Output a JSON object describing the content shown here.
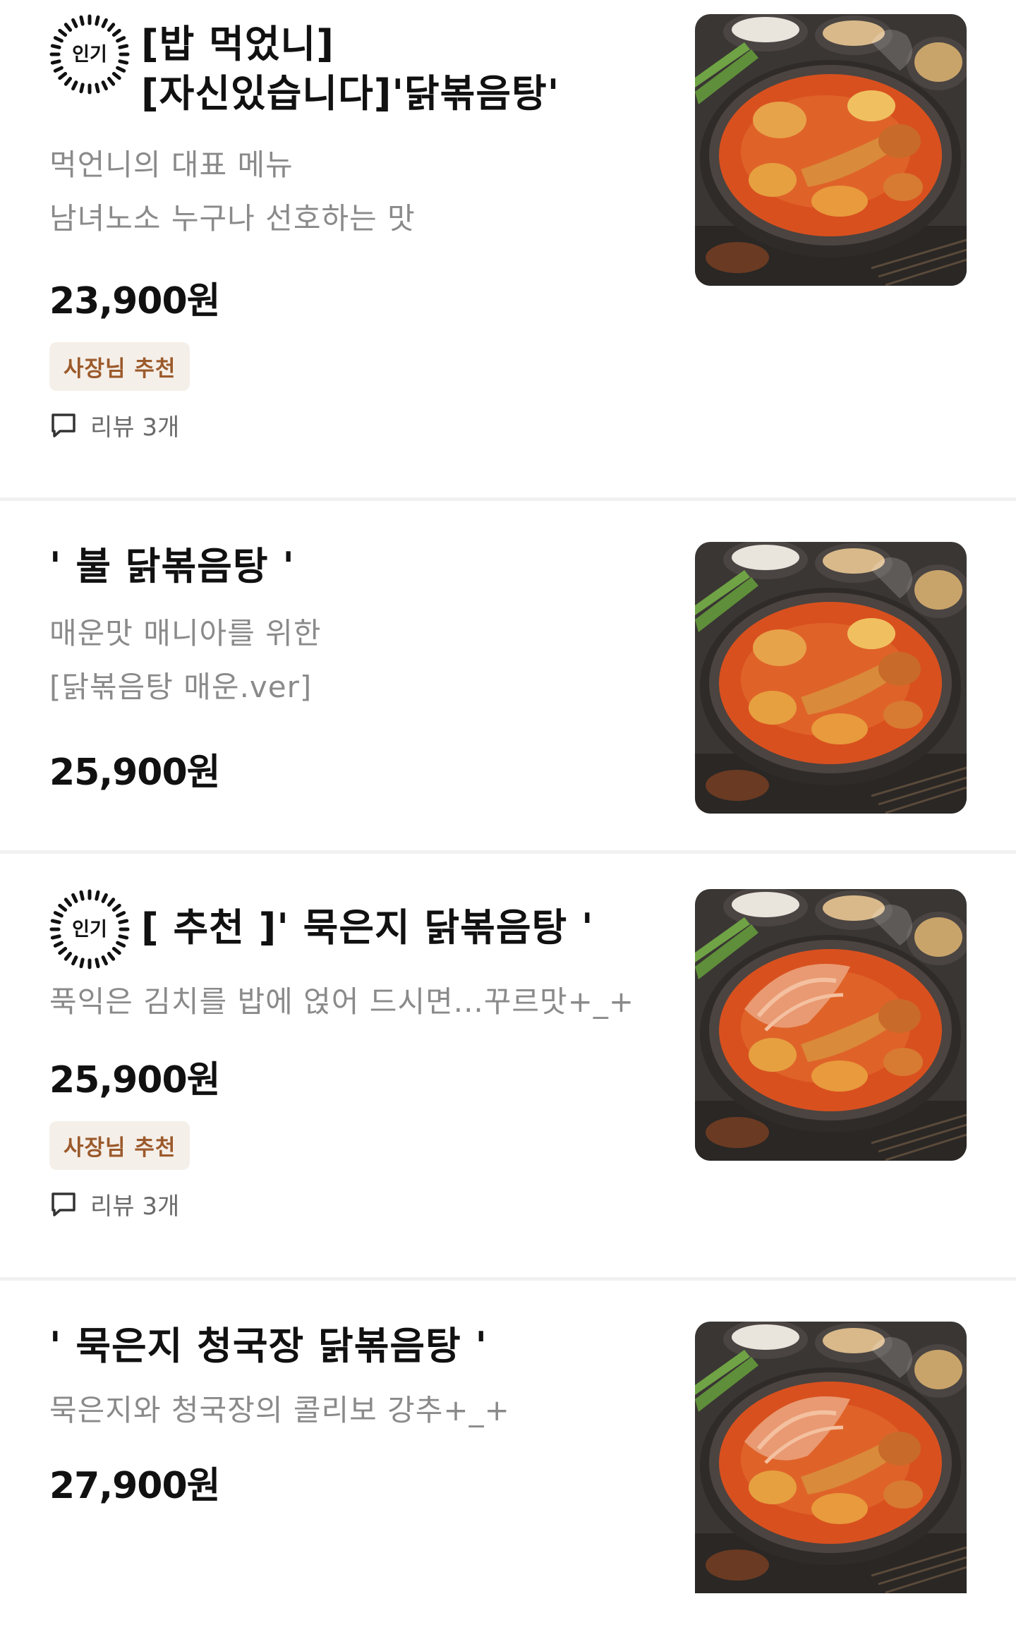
{
  "menu": {
    "items": [
      {
        "popular": true,
        "popular_label": "인기",
        "name": "[밥 먹었니]\n[자신있습니다]'닭볶음탕'",
        "description": "먹언니의 대표 메뉴\n남녀노소 누구나 선호하는 맛",
        "price": "23,900원",
        "badge": "사장님 추천",
        "review": "리뷰 3개",
        "image_icon": "dakbokkeumtang-photo"
      },
      {
        "popular": false,
        "name": "' 불 닭볶음탕 '",
        "description": "매운맛 매니아를 위한\n[닭볶음탕 매운.ver]",
        "price": "25,900원",
        "image_icon": "spicy-dakbokkeumtang-photo"
      },
      {
        "popular": true,
        "popular_label": "인기",
        "name": "[ 추천 ]' 묵은지 닭볶음탕 '",
        "description": "푹익은 김치를 밥에 얹어 드시면...꾸르맛+_+",
        "price": "25,900원",
        "badge": "사장님 추천",
        "review": "리뷰 3개",
        "image_icon": "kimchi-dakbokkeumtang-photo"
      },
      {
        "popular": false,
        "name": "' 묵은지 청국장 닭볶음탕 '",
        "description": "묵은지와 청국장의 콜리보 강추+_+",
        "price": "27,900원",
        "image_icon": "cheonggukjang-dakbokkeumtang-photo"
      }
    ]
  },
  "colors": {
    "badge_bg": "#f5efe9",
    "badge_text": "#9b5a2b",
    "desc_text": "#8a8a8a",
    "separator": "#f1f1f1",
    "stew_red": "#d9501f"
  }
}
